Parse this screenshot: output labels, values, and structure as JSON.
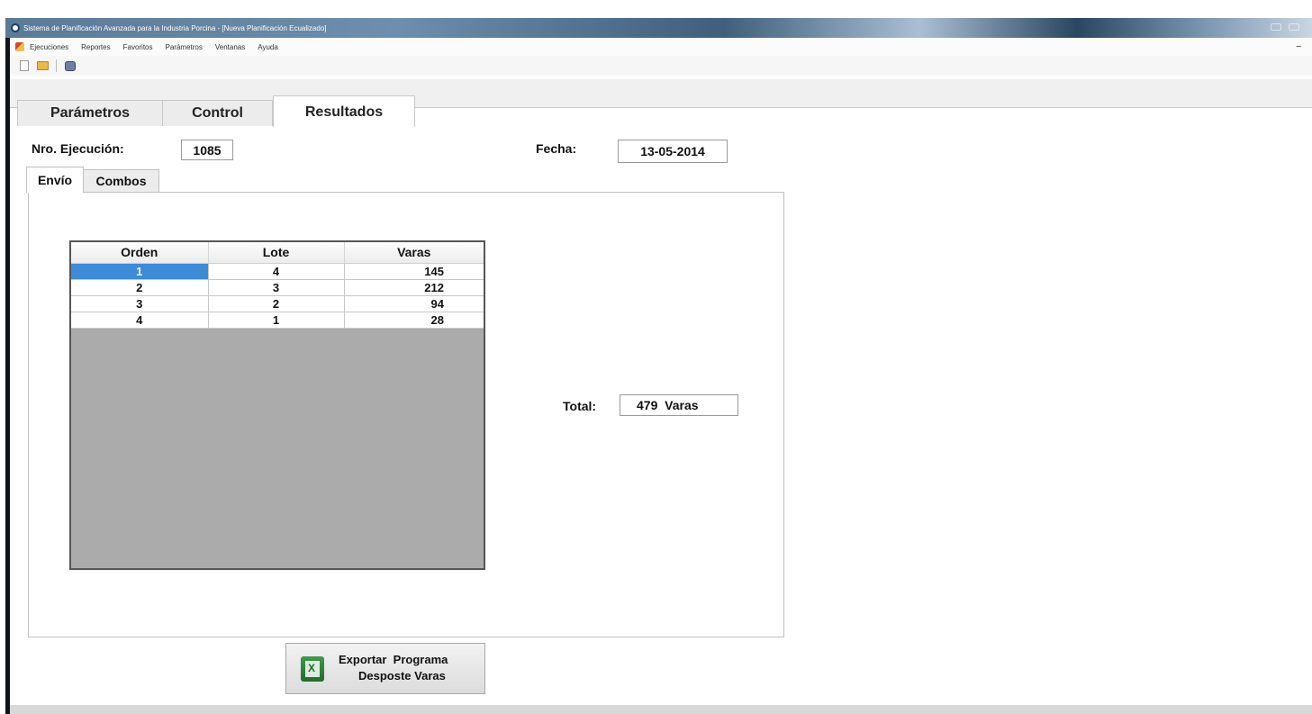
{
  "window": {
    "title": "Sistema de Planificación Avanzada para la Industria Porcina - [Nueva Planificación Ecualizado]"
  },
  "menubar": {
    "items": [
      "Ejecuciones",
      "Reportes",
      "Favoritos",
      "Parámetros",
      "Ventanas",
      "Ayuda"
    ]
  },
  "toolbar": {
    "icons": [
      "new-document-icon",
      "open-folder-icon",
      "print-icon"
    ]
  },
  "main_tabs": [
    {
      "label": "Parámetros",
      "active": false
    },
    {
      "label": "Control",
      "active": false
    },
    {
      "label": "Resultados",
      "active": true
    }
  ],
  "header": {
    "ejecucion_label": "Nro. Ejecución:",
    "ejecucion_value": "1085",
    "fecha_label": "Fecha:",
    "fecha_value": "13-05-2014"
  },
  "sub_tabs": [
    {
      "label": "Envío",
      "active": true
    },
    {
      "label": "Combos",
      "active": false
    }
  ],
  "grid": {
    "columns": [
      "Orden",
      "Lote",
      "Varas"
    ],
    "rows": [
      [
        "1",
        "4",
        "145"
      ],
      [
        "2",
        "3",
        "212"
      ],
      [
        "3",
        "2",
        "94"
      ],
      [
        "4",
        "1",
        "28"
      ]
    ],
    "selected_cell": "1"
  },
  "total": {
    "label": "Total:",
    "value": "479  Varas"
  },
  "export_button": {
    "line1": "Exportar  Programa",
    "line2": "Desposte Varas",
    "icon": "excel-icon"
  },
  "colors": {
    "selection": "#3d8ad8",
    "grid_empty": "#ababab"
  }
}
